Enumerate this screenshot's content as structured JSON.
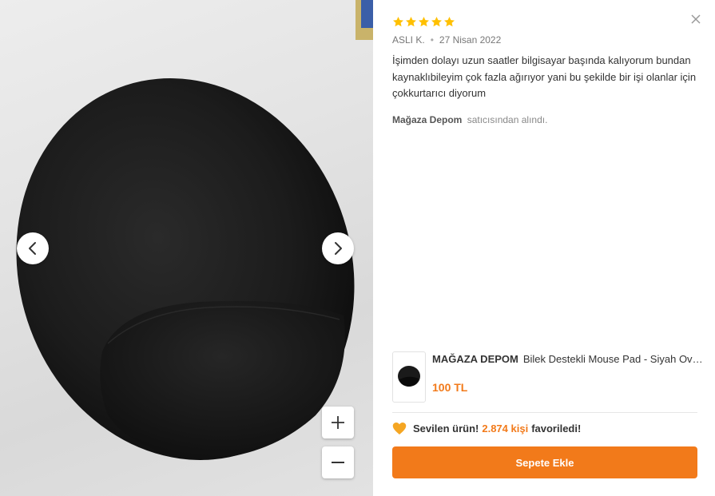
{
  "review": {
    "rating": 5,
    "max_rating": 5,
    "author": "ASLI K.",
    "date": "27 Nisan 2022",
    "text": "İşimden dolayı uzun saatler bilgisayar başında kalıyorum bundan kaynaklıbileyim çok fazla ağırıyor yani bu şekilde bir işi olanlar için çokkurtarıcı diyorum",
    "seller_name": "Mağaza Depom",
    "seller_suffix": "satıcısından alındı."
  },
  "product": {
    "brand": "MAĞAZA DEPOM",
    "name": "Bilek Destekli Mouse Pad - Siyah Oval ...",
    "price": "100 TL"
  },
  "favorites": {
    "prefix": "Sevilen ürün!",
    "count": "2.874 kişi",
    "suffix": "favoriledi!"
  },
  "actions": {
    "add_to_cart": "Sepete Ekle"
  },
  "icons": {
    "star": "star-icon",
    "close": "close-icon",
    "prev": "chevron-left-icon",
    "next": "chevron-right-icon",
    "zoom_in": "plus-icon",
    "zoom_out": "minus-icon",
    "heart": "heart-icon"
  },
  "colors": {
    "accent": "#f27a1a",
    "star": "#ffc000",
    "heart": "#f5a623"
  }
}
